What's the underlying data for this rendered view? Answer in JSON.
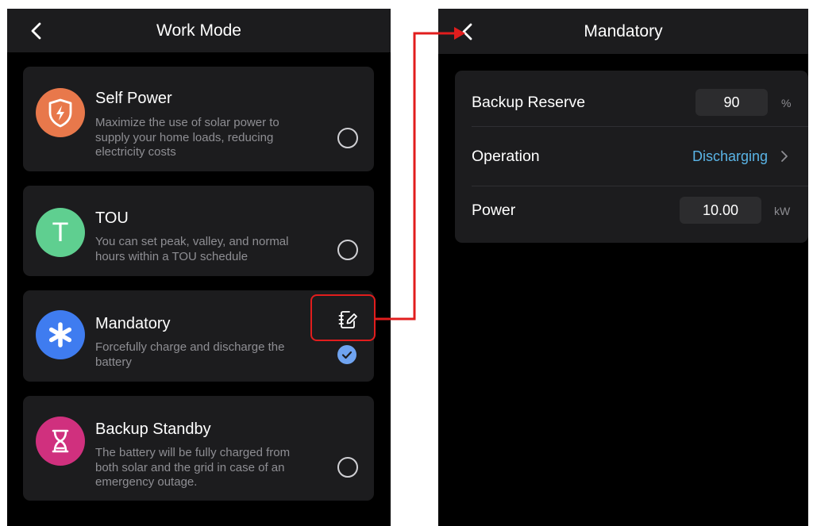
{
  "left_screen": {
    "title": "Work Mode",
    "modes": [
      {
        "name": "Self Power",
        "description_lines": [
          "Maximize the use of solar power to",
          "supply your home loads, reducing",
          "electricity costs"
        ],
        "icon": "lightning-shield-icon",
        "icon_color": "#e8784b",
        "selected": false
      },
      {
        "name": "TOU",
        "icon_letter": "T",
        "description_lines": [
          "You can set peak, valley, and normal",
          "hours within a TOU schedule"
        ],
        "icon": "letter-t-icon",
        "icon_color": "#5fcf90",
        "selected": false
      },
      {
        "name": "Mandatory",
        "description_lines": [
          "Forcefully charge and discharge the",
          "battery"
        ],
        "icon": "asterisk-icon",
        "icon_color": "#3f7cf0",
        "selected": true
      },
      {
        "name": "Backup Standby",
        "description_lines": [
          "The battery will be fully charged from",
          "both solar and the grid in case of an",
          "emergency outage."
        ],
        "icon": "hourglass-icon",
        "icon_color": "#d0307e",
        "selected": false
      }
    ]
  },
  "right_screen": {
    "title": "Mandatory",
    "rows": {
      "backup_reserve": {
        "label": "Backup Reserve",
        "value": "90",
        "unit": "%"
      },
      "operation": {
        "label": "Operation",
        "value": "Discharging"
      },
      "power": {
        "label": "Power",
        "value": "10.00",
        "unit": "kW"
      }
    }
  },
  "colors": {
    "accent": "#5ab4e6",
    "check": "#6fa3f0",
    "annotation": "#e11d1d"
  }
}
